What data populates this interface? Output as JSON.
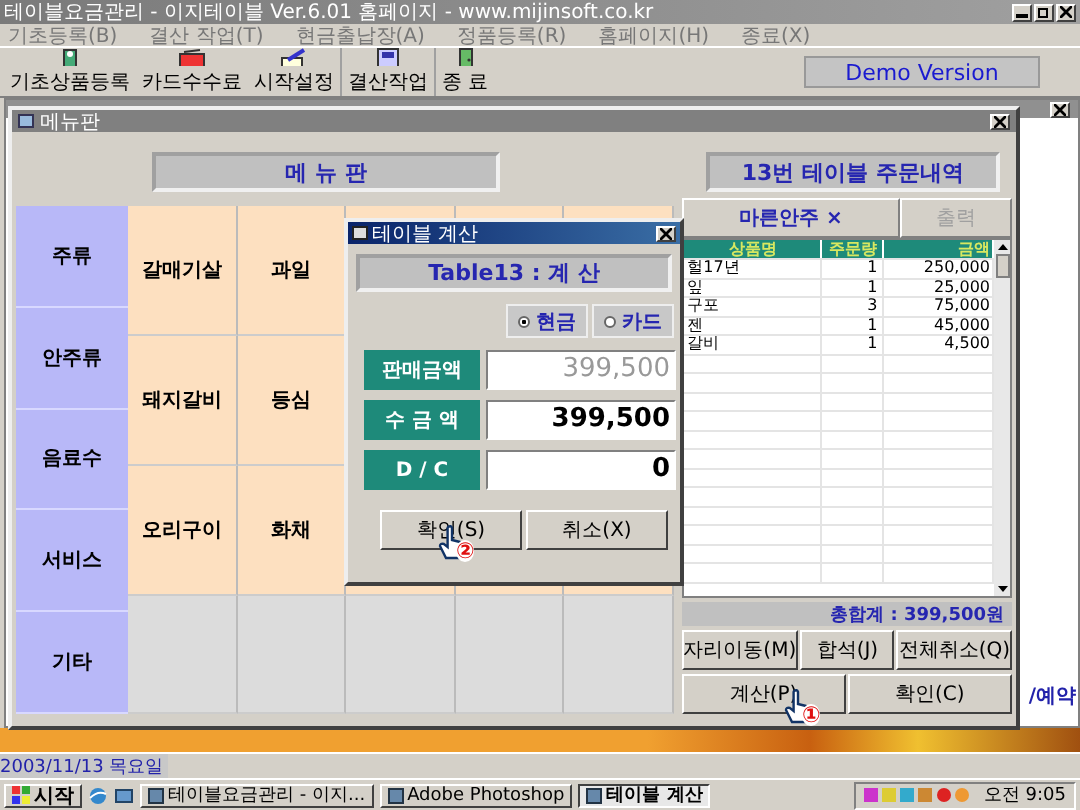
{
  "app": {
    "title": "테이블요금관리 - 이지테이블 Ver.6.01 홈페이지 - www.mijinsoft.co.kr"
  },
  "menu": [
    "기초등록(B)",
    "결산 작업(T)",
    "현금출납장(A)",
    "정품등록(R)",
    "홈페이지(H)",
    "종료(X)"
  ],
  "toolbar": [
    {
      "label": "기초상품등록",
      "kind": "register"
    },
    {
      "label": "카드수수료",
      "kind": "card"
    },
    {
      "label": "시작설정",
      "kind": "setup"
    },
    {
      "label": "결산작업",
      "kind": "report"
    },
    {
      "label": "종 료",
      "kind": "exit"
    }
  ],
  "demo_badge": "Demo Version",
  "background_window": {
    "fragment": "/예약"
  },
  "menu_window": {
    "title": "메뉴판",
    "header": "메 뉴 판",
    "categories": [
      "주류",
      "안주류",
      "음료수",
      "서비스",
      "기타"
    ],
    "item_rows": [
      {
        "filled": true,
        "items": [
          "갈매기살",
          "과일"
        ]
      },
      {
        "filled": true,
        "items": [
          "돼지갈비",
          "등심"
        ]
      },
      {
        "filled": true,
        "items": [
          "오리구이",
          "화채"
        ]
      },
      {
        "filled": false
      }
    ]
  },
  "order_panel": {
    "header": "13번 테이블 주문내역",
    "tabs": [
      {
        "label": "마른안주 ×",
        "selected": true
      },
      {
        "label": "출력",
        "selected": false
      }
    ],
    "columns": [
      "상품명",
      "주문량",
      "금액"
    ],
    "rows": [
      {
        "name": "헐17년",
        "qty": "1",
        "amount": "250,000"
      },
      {
        "name": "잎",
        "qty": "1",
        "amount": "25,000"
      },
      {
        "name": "구포",
        "qty": "3",
        "amount": "75,000"
      },
      {
        "name": "젠",
        "qty": "1",
        "amount": "45,000"
      },
      {
        "name": "갈비",
        "qty": "1",
        "amount": "4,500"
      }
    ],
    "total": "총합계 : 399,500원",
    "buttons": [
      [
        "자리이동(M)",
        "합석(J)",
        "전체취소(Q)"
      ],
      [
        "계산(P)",
        "확인(C)"
      ]
    ]
  },
  "dialog": {
    "title": "테이블 계산",
    "header": "Table13 : 계 산",
    "payment": [
      {
        "label": "현금",
        "selected": true
      },
      {
        "label": "카드",
        "selected": false
      }
    ],
    "fields": [
      {
        "label": "판매금액",
        "value": "399,500",
        "disabled": true
      },
      {
        "label": "수 금 액",
        "value": "399,500",
        "disabled": false
      },
      {
        "label": "D / C",
        "value": "0",
        "disabled": false
      }
    ],
    "buttons": [
      "확인(S)",
      "취소(X)"
    ]
  },
  "cursors": [
    {
      "step": "①"
    },
    {
      "step": "②"
    }
  ],
  "status_bar": {
    "date": "2003/11/13 목요일"
  },
  "taskbar": {
    "start": "시작",
    "tasks": [
      {
        "label": "테이블요금관리 - 이지...",
        "selected": false
      },
      {
        "label": "Adobe Photoshop",
        "selected": false
      },
      {
        "label": "테이블 계산",
        "selected": true
      }
    ],
    "clock": "오전 9:05"
  }
}
